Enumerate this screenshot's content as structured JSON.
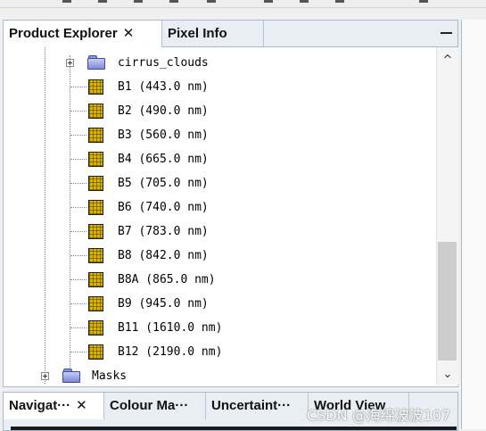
{
  "product_explorer": {
    "tabs": [
      {
        "label": "Product Explorer",
        "close": "✕"
      },
      {
        "label": "Pixel Info"
      }
    ],
    "minimize_icon": "minimize-icon",
    "tree": {
      "folder_cirrus": "cirrus_clouds",
      "bands": [
        "B1 (443.0 nm)",
        "B2 (490.0 nm)",
        "B3 (560.0 nm)",
        "B4 (665.0 nm)",
        "B5 (705.0 nm)",
        "B6 (740.0 nm)",
        "B7 (783.0 nm)",
        "B8 (842.0 nm)",
        "B8A (865.0 nm)",
        "B9 (945.0 nm)",
        "B11 (1610.0 nm)",
        "B12 (2190.0 nm)"
      ],
      "folder_masks": "Masks"
    },
    "scrollbar": {
      "up": "^",
      "down": "⌄",
      "position": 0.72
    }
  },
  "bottom_panel": {
    "tabs": [
      {
        "label": "Navigat···",
        "close": "✕"
      },
      {
        "label": "Colour Ma···"
      },
      {
        "label": "Uncertaint···"
      },
      {
        "label": "World View"
      }
    ]
  },
  "watermark": "CSDN @海绵波波107",
  "colors": {
    "tab_bar": "#e9eef5",
    "border": "#a9b9cc",
    "band_icon": "#d9b400",
    "folder": "#8e98d8"
  }
}
